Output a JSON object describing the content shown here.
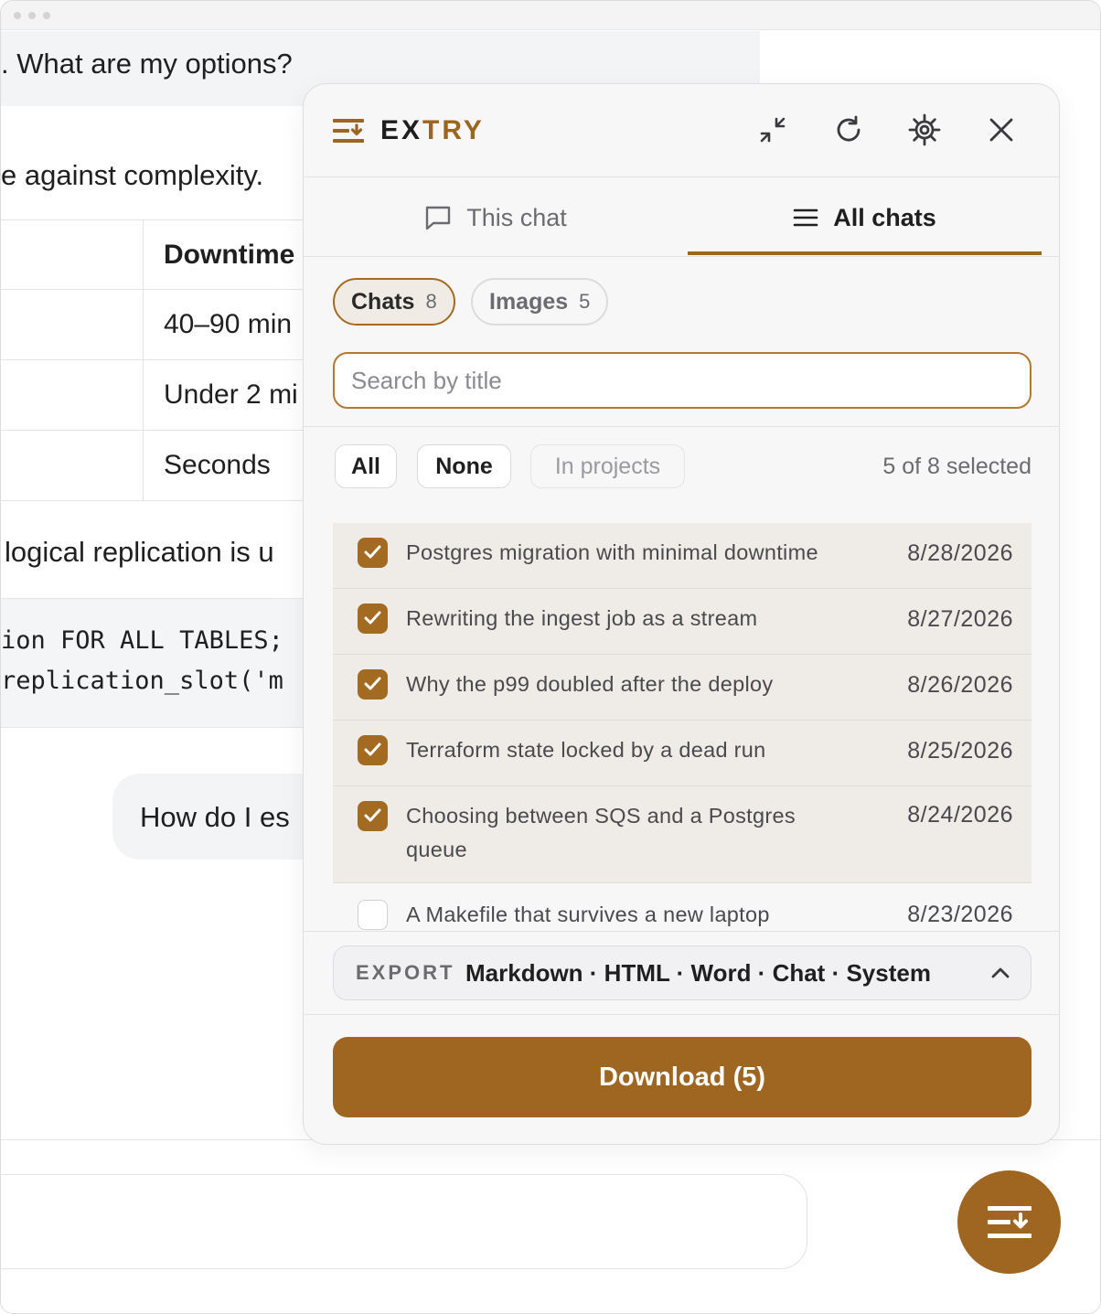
{
  "background": {
    "top_bubble_text": ". What are my options?",
    "paragraph1": "e against complexity.",
    "table": {
      "header": "Downtime",
      "rows": [
        "40–90 min",
        "Under 2 mi",
        "Seconds"
      ]
    },
    "paragraph2": "logical replication is u",
    "code_lines": [
      "ion FOR ALL TABLES;",
      "replication_slot('m"
    ],
    "user_message": "How do I es"
  },
  "panel": {
    "brand_part1": "EX",
    "brand_part2": "TRY",
    "header_icons": [
      "collapse-icon",
      "refresh-icon",
      "gear-icon",
      "close-icon"
    ],
    "tabs": [
      {
        "label": "This chat",
        "icon": "chat-bubble-icon",
        "active": false
      },
      {
        "label": "All chats",
        "icon": "menu-icon",
        "active": true
      }
    ],
    "segments": [
      {
        "label": "Chats",
        "count": "8",
        "active": true
      },
      {
        "label": "Images",
        "count": "5",
        "active": false
      }
    ],
    "search": {
      "placeholder": "Search by title",
      "value": ""
    },
    "filters": {
      "all": "All",
      "none": "None",
      "in_projects": "In projects"
    },
    "selected_text": "5 of 8 selected",
    "chats": [
      {
        "title": "Postgres migration with minimal downtime",
        "date": "8/28/2026",
        "checked": true
      },
      {
        "title": "Rewriting the ingest job as a stream",
        "date": "8/27/2026",
        "checked": true
      },
      {
        "title": "Why the p99 doubled after the deploy",
        "date": "8/26/2026",
        "checked": true
      },
      {
        "title": "Terraform state locked by a dead run",
        "date": "8/25/2026",
        "checked": true
      },
      {
        "title": "Choosing between SQS and a Postgres queue",
        "date": "8/24/2026",
        "checked": true
      },
      {
        "title": "A Makefile that survives a new laptop",
        "date": "8/23/2026",
        "checked": false
      }
    ],
    "export": {
      "label": "EXPORT",
      "formats": "Markdown · HTML · Word · Chat · System"
    },
    "download_label": "Download (5)"
  },
  "colors": {
    "accent": "#9e6621",
    "selected_row_bg": "#efebe6"
  }
}
